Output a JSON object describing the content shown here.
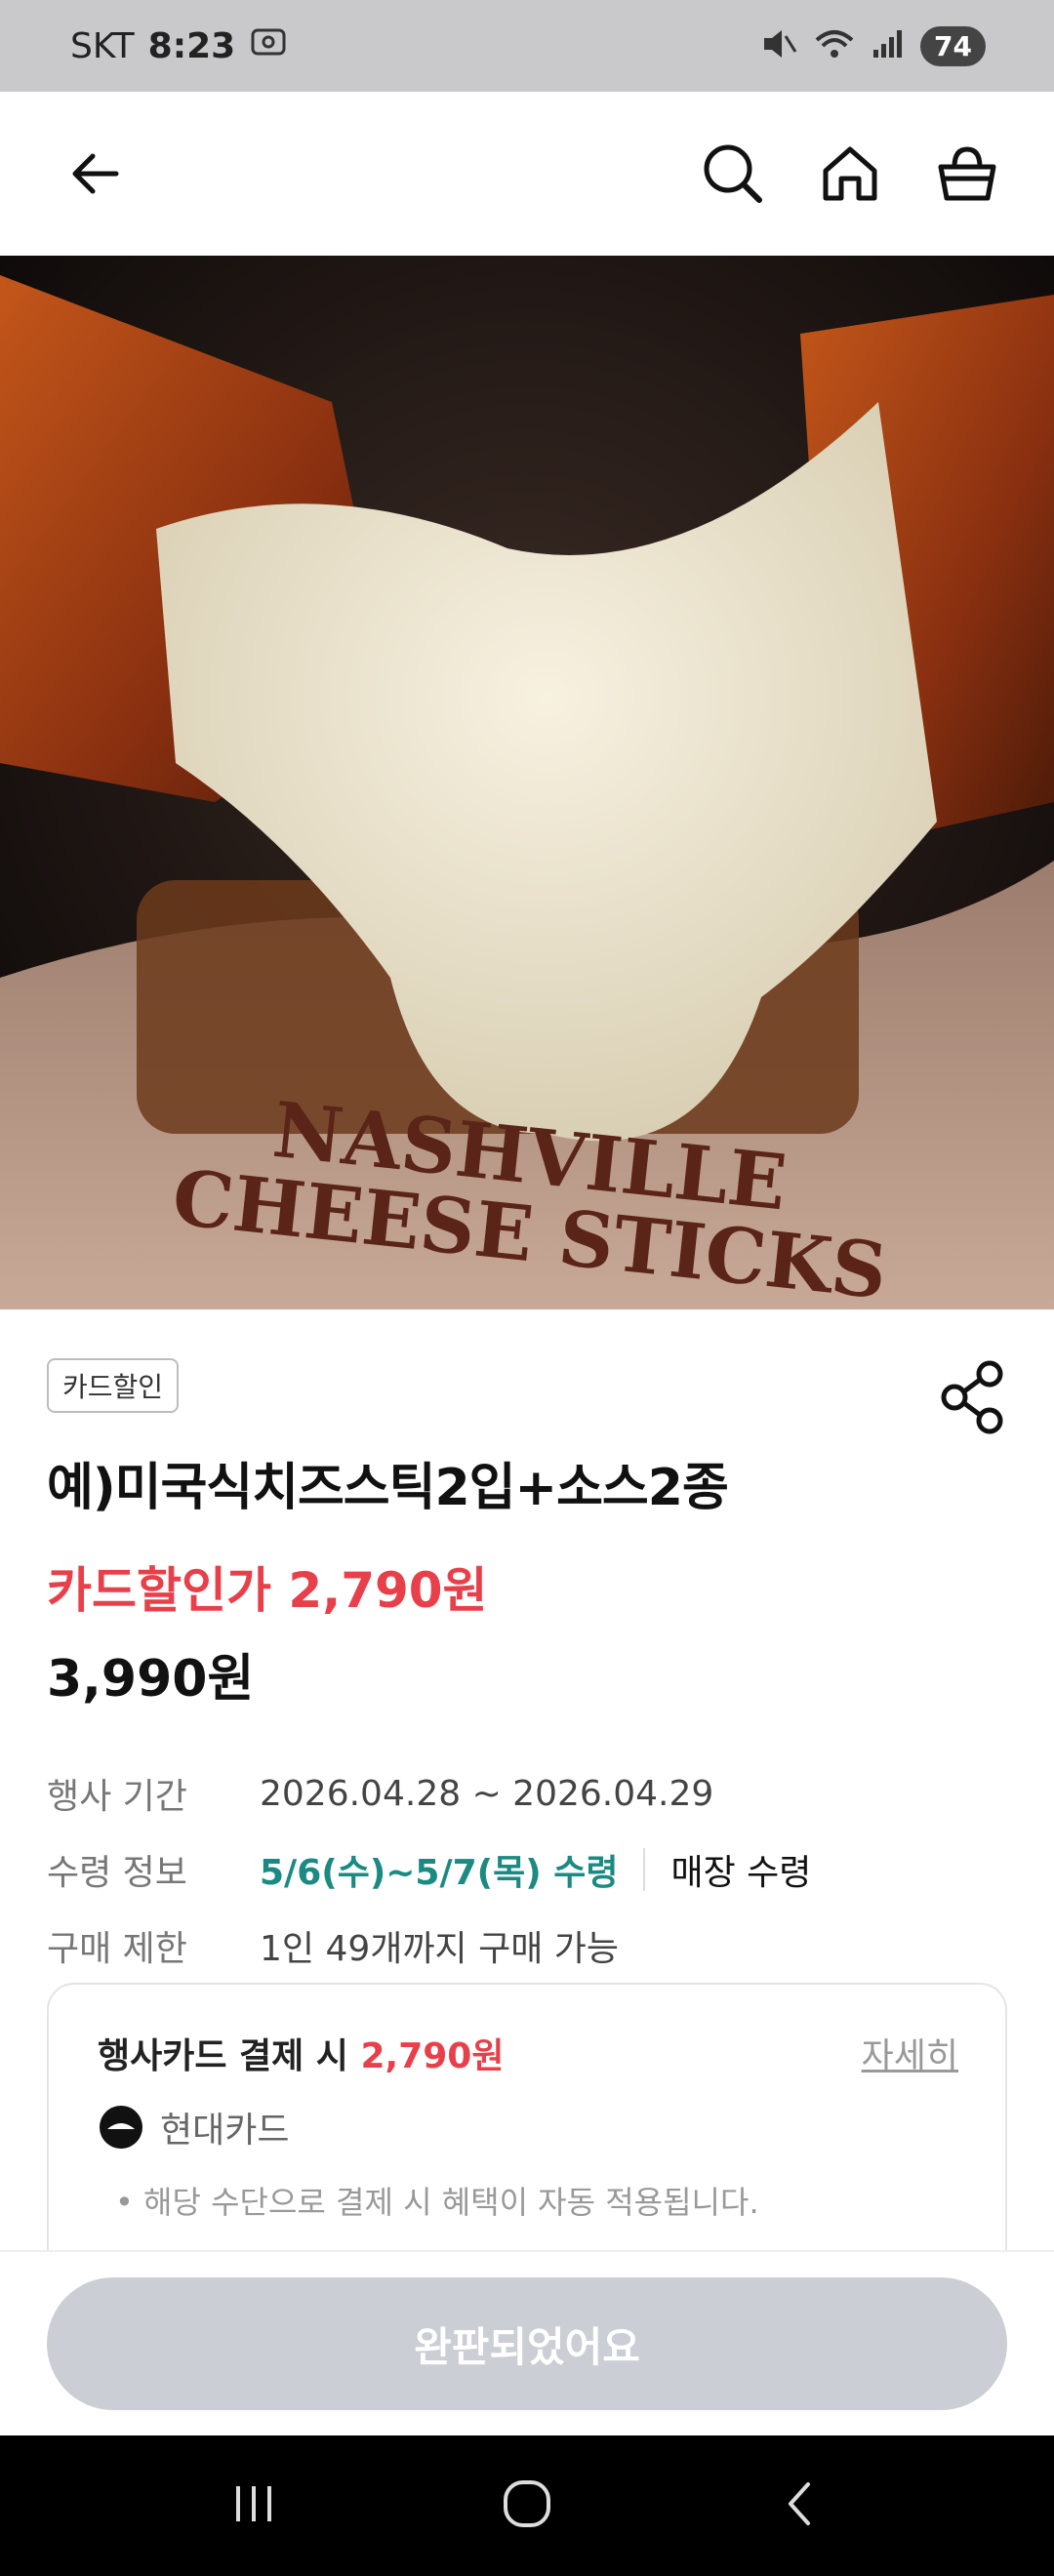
{
  "status_bar": {
    "carrier": "SKT",
    "time": "8:23",
    "battery": "74"
  },
  "appbar": {
    "icons": [
      "back-arrow-icon",
      "search-icon",
      "home-icon",
      "basket-icon"
    ]
  },
  "hero": {
    "image_caption_line1": "NASHVILLE",
    "image_caption_line2": "CHEESE STICKS"
  },
  "product": {
    "badge": "카드할인",
    "title": "예)미국식치즈스틱2입+소스2종",
    "sale_price_label": "카드할인가 2,790원",
    "price": "3,990원"
  },
  "info": {
    "period_label": "행사 기간",
    "period_value": "2026.04.28 ~ 2026.04.29",
    "pickup_label": "수령 정보",
    "pickup_date": "5/6(수)~5/7(목) 수령",
    "pickup_place": "매장 수령",
    "limit_label": "구매 제한",
    "limit_value": "1인 49개까지 구매 가능"
  },
  "card_benefit": {
    "head_prefix": "행사카드 결제 시",
    "head_price": "2,790원",
    "detail_link": "자세히",
    "bank": "현대카드",
    "note": "해당 수단으로 결제 시 혜택이 자동 적용됩니다."
  },
  "cta": {
    "label": "완판되었어요"
  },
  "colors": {
    "accent_red": "#e8404a",
    "accent_green": "#1a8a82",
    "disabled_button": "#cbced4"
  }
}
